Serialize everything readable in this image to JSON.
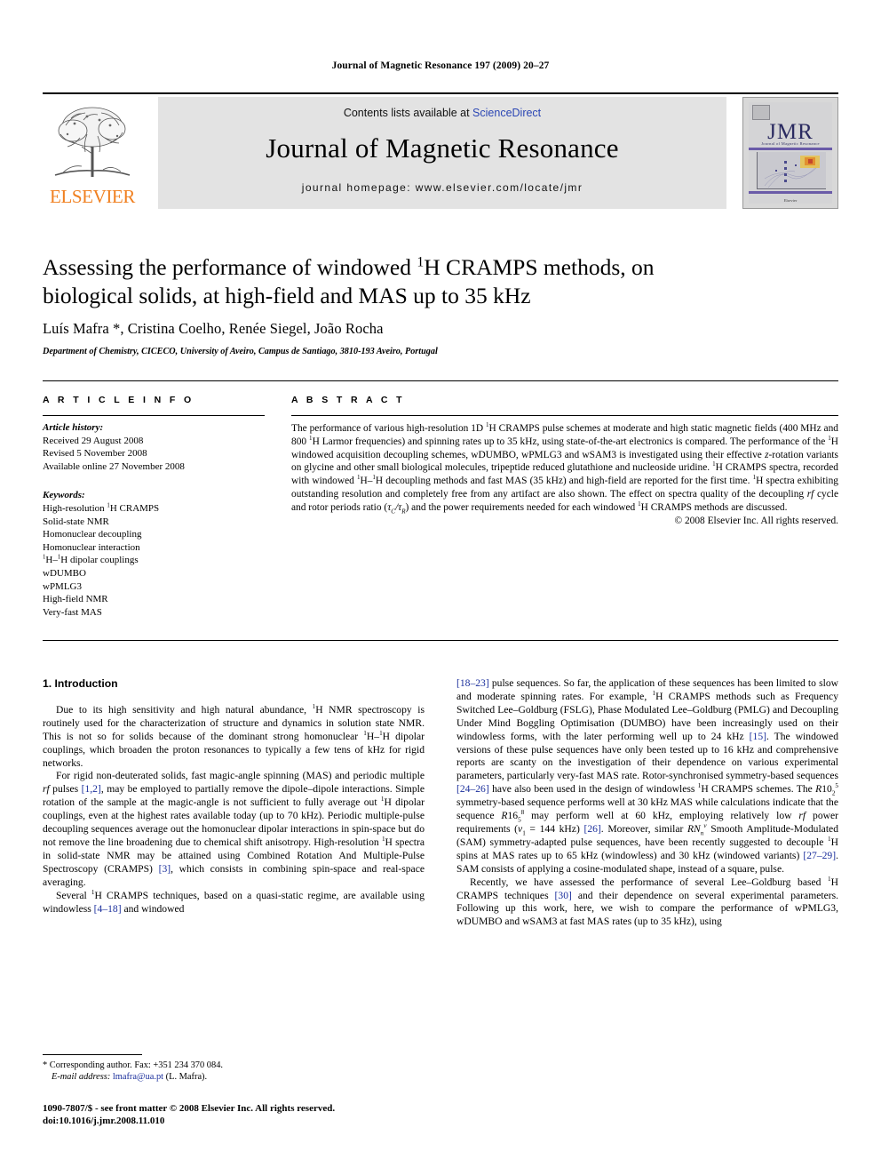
{
  "running_head": "Journal of Magnetic Resonance 197 (2009) 20–27",
  "masthead": {
    "publisher": "ELSEVIER",
    "contents_prefix": "Contents lists available at ",
    "contents_link": "ScienceDirect",
    "journal_title": "Journal of Magnetic Resonance",
    "homepage": "journal homepage: www.elsevier.com/locate/jmr",
    "cover": {
      "wordmark": "JMR",
      "subtitle": "Journal of Magnetic Resonance",
      "footer": "Elsevier"
    },
    "link_color": "#2b46b4",
    "banner_bg": "#e3e3e3",
    "elsevier_orange": "#F08020"
  },
  "article": {
    "title_line1_a": "Assessing the performance of windowed ",
    "title_sup1": "1",
    "title_line1_b": "H CRAMPS methods, on biological",
    "title_line2": "solids, at high-field and MAS up to 35 kHz",
    "authors": "Luís Mafra *, Cristina Coelho, Renée Siegel, João Rocha",
    "affiliation": "Department of Chemistry, CICECO, University of Aveiro, Campus de Santiago, 3810-193 Aveiro, Portugal"
  },
  "info": {
    "heading": "A R T I C L E   I N F O",
    "history_label": "Article history:",
    "history": [
      "Received 29 August 2008",
      "Revised 5 November 2008",
      "Available online 27 November 2008"
    ],
    "keywords_label": "Keywords:",
    "keywords": [
      "High-resolution 1H CRAMPS",
      "Solid-state NMR",
      "Homonuclear decoupling",
      "Homonuclear interaction",
      "1H–1H dipolar couplings",
      "wDUMBO",
      "wPMLG3",
      "High-field NMR",
      "Very-fast MAS"
    ]
  },
  "abstract": {
    "heading": "A B S T R A C T",
    "text": "The performance of various high-resolution 1D 1H CRAMPS pulse schemes at moderate and high static magnetic fields (400 MHz and 800 1H Larmor frequencies) and spinning rates up to 35 kHz, using state-of-the-art electronics is compared. The performance of the 1H windowed acquisition decoupling schemes, wDUMBO, wPMLG3 and wSAM3 is investigated using their effective z-rotation variants on glycine and other small biological molecules, tripeptide reduced glutathione and nucleoside uridine. 1H CRAMPS spectra, recorded with windowed 1H–1H decoupling methods and fast MAS (35 kHz) and high-field are reported for the first time. 1H spectra exhibiting outstanding resolution and completely free from any artifact are also shown. The effect on spectra quality of the decoupling rf cycle and rotor periods ratio (τC/τR) and the power requirements needed for each windowed 1H CRAMPS methods are discussed.",
    "copyright": "© 2008 Elsevier Inc. All rights reserved."
  },
  "body": {
    "section_heading": "1. Introduction",
    "left_paragraphs": [
      "Due to its high sensitivity and high natural abundance, 1H NMR spectroscopy is routinely used for the characterization of structure and dynamics in solution state NMR. This is not so for solids because of the dominant strong homonuclear 1H–1H dipolar couplings, which broaden the proton resonances to typically a few tens of kHz for rigid networks.",
      "For rigid non-deuterated solids, fast magic-angle spinning (MAS) and periodic multiple rf pulses [1,2], may be employed to partially remove the dipole–dipole interactions. Simple rotation of the sample at the magic-angle is not sufficient to fully average out 1H dipolar couplings, even at the highest rates available today (up to 70 kHz). Periodic multiple-pulse decoupling sequences average out the homonuclear dipolar interactions in spin-space but do not remove the line broadening due to chemical shift anisotropy. High-resolution 1H spectra in solid-state NMR may be attained using Combined Rotation And Multiple-Pulse Spectroscopy (CRAMPS) [3], which consists in combining spin-space and real-space averaging.",
      "Several 1H CRAMPS techniques, based on a quasi-static regime, are available using windowless [4–18] and windowed"
    ],
    "right_paragraphs": [
      "[18–23] pulse sequences. So far, the application of these sequences has been limited to slow and moderate spinning rates. For example, 1H CRAMPS methods such as Frequency Switched Lee–Goldburg (FSLG), Phase Modulated Lee–Goldburg (PMLG) and Decoupling Under Mind Boggling Optimisation (DUMBO) have been increasingly used on their windowless forms, with the later performing well up to 24 kHz [15]. The windowed versions of these pulse sequences have only been tested up to 16 kHz and comprehensive reports are scanty on the investigation of their dependence on various experimental parameters, particularly very-fast MAS rate. Rotor-synchronised symmetry-based sequences [24–26] have also been used in the design of windowless 1H CRAMPS schemes. The R1025 symmetry-based sequence performs well at 30 kHz MAS while calculations indicate that the sequence R1658 may perform well at 60 kHz, employing relatively low rf power requirements (ν1 = 144 kHz) [26]. Moreover, similar RNnv Smooth Amplitude-Modulated (SAM) symmetry-adapted pulse sequences, have been recently suggested to decouple 1H spins at MAS rates up to 65 kHz (windowless) and 30 kHz (windowed variants) [27–29]. SAM consists of applying a cosine-modulated shape, instead of a square, pulse.",
      "Recently, we have assessed the performance of several Lee–Goldburg based 1H CRAMPS techniques [30] and their dependence on several experimental parameters. Following up this work, here, we wish to compare the performance of wPMLG3, wDUMBO and wSAM3 at fast MAS rates (up to 35 kHz), using"
    ]
  },
  "footnote": {
    "corresponding": "* Corresponding author. Fax: +351 234 370 084.",
    "email_label": "E-mail address:",
    "email": "lmafra@ua.pt",
    "email_owner": "(L. Mafra)."
  },
  "footer": {
    "issn_line": "1090-7807/$ - see front matter © 2008 Elsevier Inc. All rights reserved.",
    "doi_line": "doi:10.1016/j.jmr.2008.11.010"
  }
}
